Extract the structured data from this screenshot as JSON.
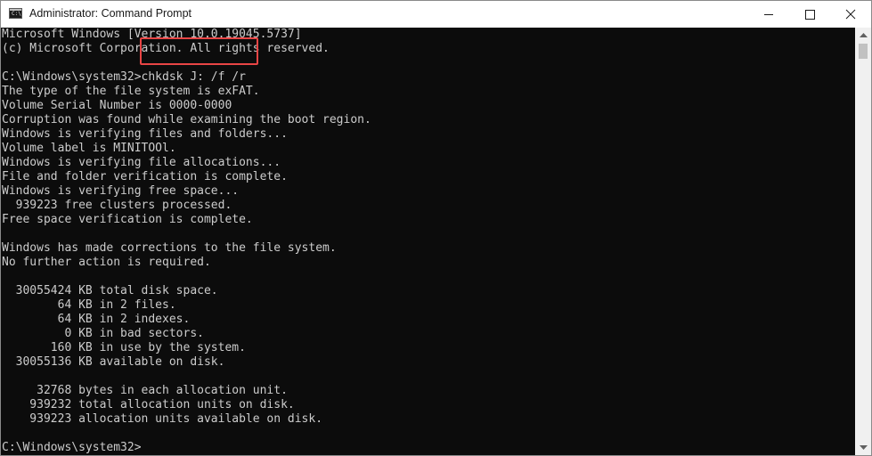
{
  "window": {
    "title": "Administrator: Command Prompt",
    "icon_label": "C:\\",
    "icon": "cmd-icon"
  },
  "controls": {
    "minimize_icon": "minimize-icon",
    "maximize_icon": "maximize-icon",
    "close_icon": "close-icon"
  },
  "console": {
    "lines": [
      "Microsoft Windows [Version 10.0.19045.5737]",
      "(c) Microsoft Corporation. All rights reserved.",
      "",
      "C:\\Windows\\system32>chkdsk J: /f /r",
      "The type of the file system is exFAT.",
      "Volume Serial Number is 0000-0000",
      "Corruption was found while examining the boot region.",
      "Windows is verifying files and folders...",
      "Volume label is MINITOOl.",
      "Windows is verifying file allocations...",
      "File and folder verification is complete.",
      "Windows is verifying free space...",
      "  939223 free clusters processed.",
      "Free space verification is complete.",
      "",
      "Windows has made corrections to the file system.",
      "No further action is required.",
      "",
      "  30055424 KB total disk space.",
      "        64 KB in 2 files.",
      "        64 KB in 2 indexes.",
      "         0 KB in bad sectors.",
      "       160 KB in use by the system.",
      "  30055136 KB available on disk.",
      "",
      "     32768 bytes in each allocation unit.",
      "    939232 total allocation units on disk.",
      "    939223 allocation units available on disk.",
      "",
      "C:\\Windows\\system32>"
    ]
  },
  "annotation": {
    "highlight_color": "#e84545",
    "highlighted_text": "chkdsk J: /f /r"
  },
  "colors": {
    "console_bg": "#0c0c0c",
    "console_text": "#cccccc"
  }
}
